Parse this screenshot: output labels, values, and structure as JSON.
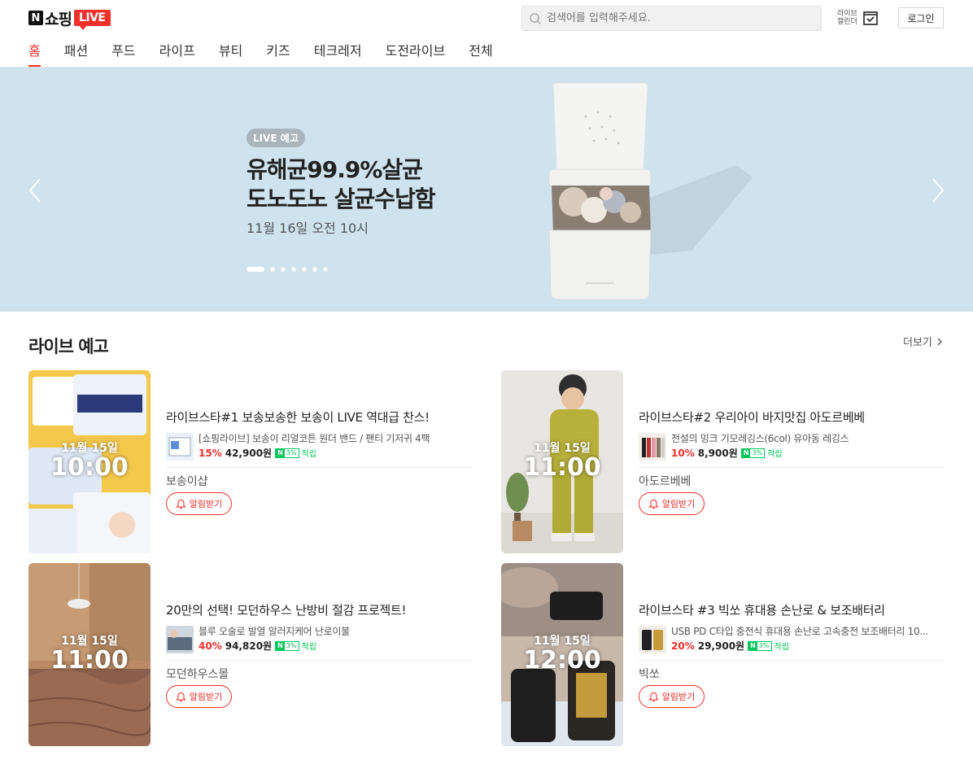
{
  "header": {
    "logo_text": "쇼핑",
    "logo_live": "LIVE",
    "search_placeholder": "검색어를 입력해주세요.",
    "calendar_label": "라이브 캘린더",
    "login_label": "로그인"
  },
  "nav": {
    "items": [
      "홈",
      "패션",
      "푸드",
      "라이프",
      "뷰티",
      "키즈",
      "테크레저",
      "도전라이브",
      "전체"
    ]
  },
  "banner": {
    "badge": "LIVE 예고",
    "title_line1": "유해균99.9%살균",
    "title_line2": "도노도노 살균수납함",
    "date": "11월 16일 오전 10시",
    "background": "#cfe3ef"
  },
  "section": {
    "title": "라이브 예고",
    "more": "더보기"
  },
  "cards": [
    {
      "date": "11월 15일",
      "time": "10:00",
      "title": "라이브스타#1 보송보송한 보송이 LIVE 역대급 찬스!",
      "product": "[쇼핑라이브] 보송이 리얼코튼 원더 밴드 / 팬티 기저귀 4팩",
      "discount": "15%",
      "price": "42,900원",
      "npay_pct": "3%",
      "reward": "적립",
      "seller": "보송이샵",
      "alarm": "알림받기"
    },
    {
      "date": "11월 15일",
      "time": "11:00",
      "title": "라이브스타#2 우리아이 바지맛집 아도르베베",
      "product": "전설의 밍크 기모레깅스(6col) 유아동 레깅스",
      "discount": "10%",
      "price": "8,900원",
      "npay_pct": "3%",
      "reward": "적립",
      "seller": "아도르베베",
      "alarm": "알림받기"
    },
    {
      "date": "11월 15일",
      "time": "11:00",
      "title": "20만의 선택! 모던하우스 난방비 절감 프로젝트!",
      "product": "블루 오술로 발열 알러지케어 난로이불",
      "discount": "40%",
      "price": "94,820원",
      "npay_pct": "3%",
      "reward": "적립",
      "seller": "모던하우스몰",
      "alarm": "알림받기"
    },
    {
      "date": "11월 15일",
      "time": "12:00",
      "title": "라이브스타 #3 빅쏘 휴대용 손난로 & 보조배터리",
      "product": "USB PD C타입 충전식 휴대용 손난로 고속충전 보조배터리 10...",
      "discount": "20%",
      "price": "29,900원",
      "npay_pct": "3%",
      "reward": "적립",
      "seller": "빅쏘",
      "alarm": "알림받기"
    }
  ],
  "colors": {
    "accent": "#f0302b",
    "npay": "#03c75a"
  }
}
